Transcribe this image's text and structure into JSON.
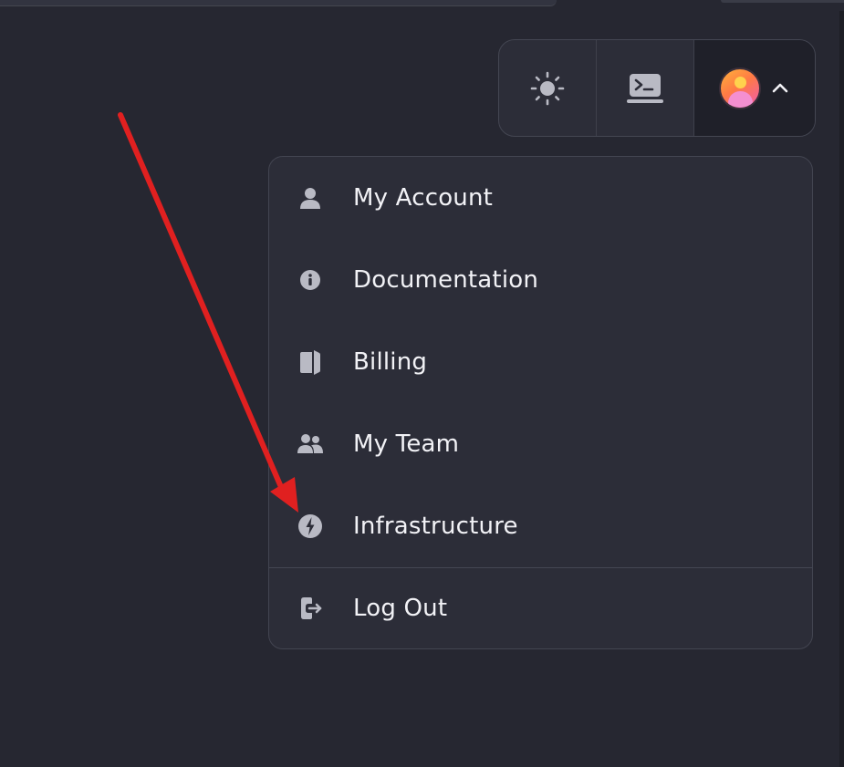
{
  "toolbar": {
    "theme_icon": "sun-icon",
    "console_icon": "terminal-icon",
    "profile_icon": "user-avatar",
    "expand_icon": "chevron-up-icon"
  },
  "menu": {
    "items": [
      {
        "label": "My Account",
        "icon": "user-icon"
      },
      {
        "label": "Documentation",
        "icon": "info-icon"
      },
      {
        "label": "Billing",
        "icon": "wallet-icon"
      },
      {
        "label": "My Team",
        "icon": "team-icon"
      },
      {
        "label": "Infrastructure",
        "icon": "bolt-icon"
      },
      {
        "label": "Log Out",
        "icon": "logout-icon"
      }
    ]
  },
  "annotation": {
    "arrow_color": "#e02020",
    "points_to": "Infrastructure"
  },
  "colors": {
    "background": "#262731",
    "panel": "#2c2d38",
    "border": "#444652",
    "text": "#f2f2f6",
    "icon": "#b9bac4"
  }
}
